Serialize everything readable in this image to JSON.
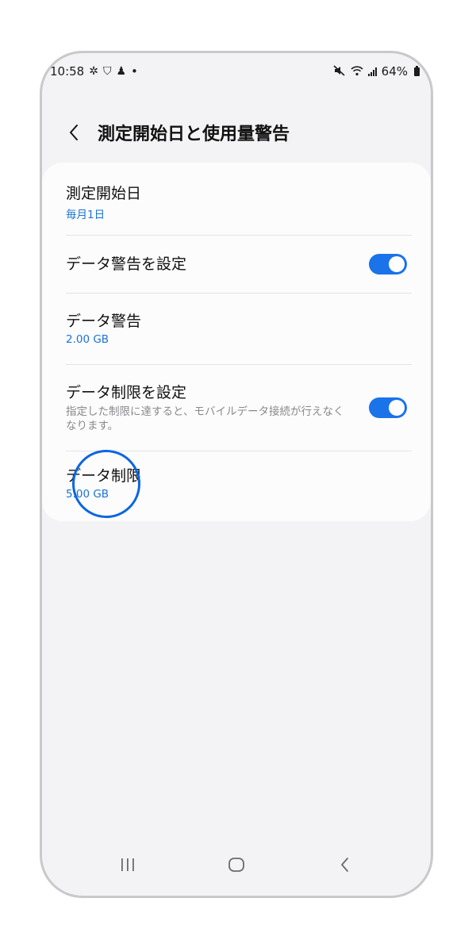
{
  "status_bar": {
    "time": "10:58",
    "notification_icons": [
      "settings-gear-icon",
      "shield-badge-icon",
      "figure-icon"
    ],
    "dot": "•",
    "battery_percent": "64%"
  },
  "header": {
    "title": "測定開始日と使用量警告"
  },
  "settings": {
    "start_date": {
      "title": "測定開始日",
      "value": "毎月1日"
    },
    "set_warning": {
      "title": "データ警告を設定",
      "enabled": true
    },
    "warning": {
      "title": "データ警告",
      "value": "2.00 GB"
    },
    "set_limit": {
      "title": "データ制限を設定",
      "description": "指定した制限に達すると、モバイルデータ接続が行えなくなります。",
      "enabled": true
    },
    "limit": {
      "title": "データ制限",
      "value": "5.00 GB"
    }
  },
  "colors": {
    "accent": "#1a73e8",
    "link_value": "#1a73d6",
    "tap_indicator": "#0a66e0",
    "background": "#f3f3f5"
  }
}
